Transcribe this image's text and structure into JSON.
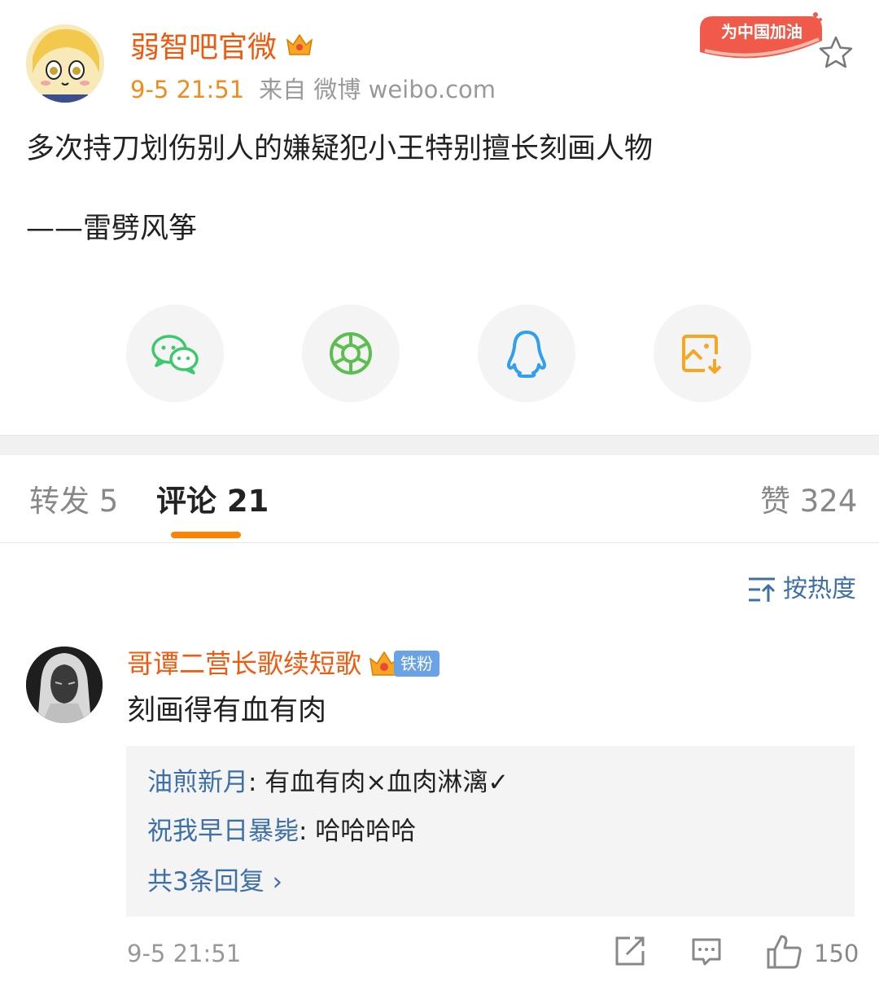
{
  "post": {
    "author": "弱智吧官微",
    "time": "9-5 21:51",
    "source": "来自 微博 weibo.com",
    "badge": "为中国加油",
    "text": "多次持刀划伤别人的嫌疑犯小王特别擅长刻画人物",
    "signature": "——雷劈风筝"
  },
  "share": {
    "items": [
      "wechat-icon",
      "moments-icon",
      "qq-icon",
      "save-image-icon"
    ]
  },
  "tabs": {
    "repost": "转发 5",
    "comments": "评论 21",
    "likes": "赞 324"
  },
  "sort": {
    "label": "按热度"
  },
  "comment": {
    "author": "哥谭二营长歌续短歌",
    "fan_badge": "铁粉",
    "text": "刻画得有血有肉",
    "replies": [
      {
        "name": "油煎新月",
        "text": ": 有血有肉×血肉淋漓✓"
      },
      {
        "name": "祝我早日暴毙",
        "text": ": 哈哈哈哈"
      }
    ],
    "more_replies": "共3条回复 ›",
    "time": "9-5 21:51",
    "like_count": "150"
  },
  "colors": {
    "accent": "#ff8200",
    "author": "#f05a0f",
    "link": "#3d6fa8",
    "wechat": "#3cc96a",
    "moments": "#5bbf4f",
    "qq": "#2f9ff0",
    "save": "#f5a623"
  }
}
